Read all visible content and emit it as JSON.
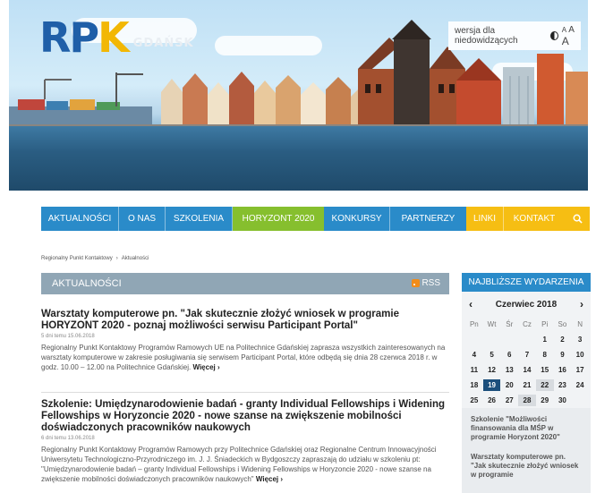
{
  "header": {
    "logo": {
      "letters": [
        "R",
        "P",
        "K"
      ],
      "city": "GDAŃSK"
    },
    "accessibility": {
      "label": "wersja dla niedowidzących",
      "sizes": [
        "A",
        "A",
        "A"
      ]
    }
  },
  "nav": {
    "items": [
      {
        "label": "AKTUALNOŚCI",
        "color": "#2a8bc9"
      },
      {
        "label": "O NAS",
        "color": "#2a8bc9"
      },
      {
        "label": "SZKOLENIA",
        "color": "#2a8bc9"
      },
      {
        "label": "HORYZONT 2020",
        "color": "#86bf2e"
      },
      {
        "label": "KONKURSY",
        "color": "#2a8bc9"
      },
      {
        "label": "PARTNERZY",
        "color": "#2a8bc9"
      },
      {
        "label": "LINKI",
        "color": "#f6be13"
      },
      {
        "label": "KONTAKT",
        "color": "#f6be13"
      }
    ],
    "search_icon": "search-icon"
  },
  "breadcrumb": {
    "home": "Regionalny Punkt Kontaktowy",
    "separator": "›",
    "current": "Aktualności"
  },
  "news": {
    "header": "AKTUALNOŚCI",
    "rss_label": "RSS",
    "articles": [
      {
        "title": "Warsztaty komputerowe pn. \"Jak skutecznie złożyć wniosek w programie HORYZONT 2020 - poznaj możliwości serwisu Participant Portal\"",
        "date": "5 dni temu 15.06.2018",
        "body": "Regionalny Punkt Kontaktowy Programów Ramowych UE na Politechnice Gdańskiej zaprasza wszystkich zainteresowanych na warsztaty komputerowe w zakresie posługiwania się serwisem Participant Portal, które odbędą się dnia 28 czerwca 2018 r. w godz. 10.00 – 12.00 na Politechnice Gdańskiej.",
        "more": "Więcej ›"
      },
      {
        "title": "Szkolenie: Umiędzynarodowienie badań - granty Individual Fellowships i Widening Fellowships w Horyzoncie 2020 - nowe szanse na zwiększenie mobilności doświadczonych pracowników naukowych",
        "date": "6 dni temu 13.06.2018",
        "body": "Regionalny Punkt Kontaktowy Programów Ramowych przy Politechnice Gdańskiej oraz Regionalne Centrum Innowacyjności Uniwersytetu Technologiczno-Przyrodniczego im. J. J. Śniadeckich w Bydgoszczy zapraszają do udziału w szkoleniu pt: \"Umiędzynarodowienie badań – granty Individual Fellowships i Widening Fellowships w Horyzoncie 2020 - nowe szanse na zwiększenie mobilności doświadczonych pracowników naukowych\"",
        "more": "Więcej ›"
      }
    ]
  },
  "sidebar": {
    "header": "NAJBLIŻSZE WYDARZENIA",
    "calendar": {
      "month": "Czerwiec 2018",
      "prev": "‹",
      "next": "›",
      "days_of_week": [
        "Pn",
        "Wt",
        "Śr",
        "Cz",
        "Pi",
        "So",
        "N"
      ],
      "weeks": [
        [
          "",
          "",
          "",
          "",
          "1",
          "2",
          "3"
        ],
        [
          "4",
          "5",
          "6",
          "7",
          "8",
          "9",
          "10"
        ],
        [
          "11",
          "12",
          "13",
          "14",
          "15",
          "16",
          "17"
        ],
        [
          "18",
          "19",
          "20",
          "21",
          "22",
          "23",
          "24"
        ],
        [
          "25",
          "26",
          "27",
          "28",
          "29",
          "30",
          ""
        ]
      ],
      "today": "19",
      "highlighted": [
        "22",
        "28"
      ],
      "today_color": "#1c4f7c"
    },
    "events": [
      "Szkolenie \"Możliwości finansowania dla MŚP w programie Horyzont 2020\"",
      "Warsztaty komputerowe pn. \"Jak skutecznie złożyć wniosek w programie"
    ]
  }
}
